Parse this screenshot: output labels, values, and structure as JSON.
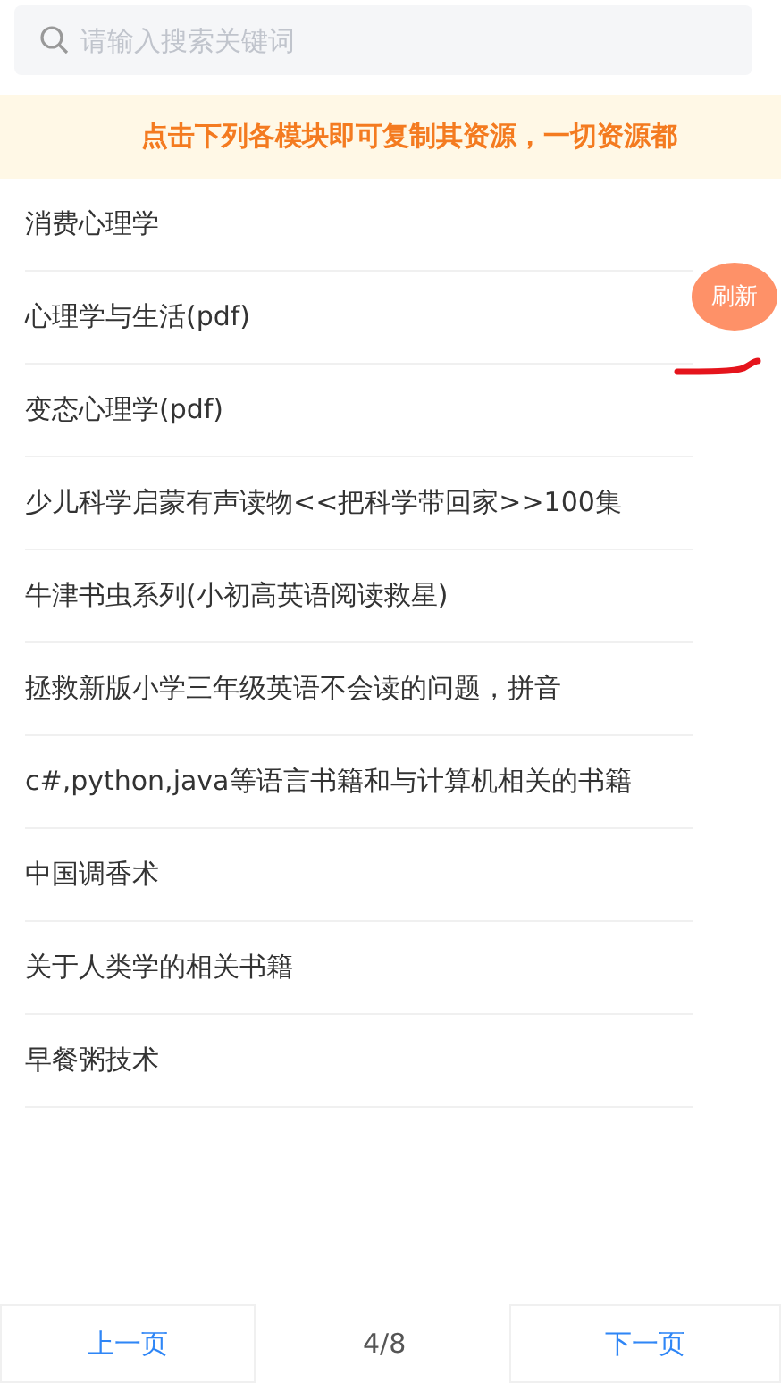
{
  "search": {
    "placeholder": "请输入搜索关键词"
  },
  "notice": "点击下列各模块即可复制其资源，一切资源都",
  "items": [
    "消费心理学",
    "心理学与生活(pdf)",
    "变态心理学(pdf)",
    "少儿科学启蒙有声读物<<把科学带回家>>100集",
    "牛津书虫系列(小初高英语阅读救星)",
    "拯救新版小学三年级英语不会读的问题，拼音",
    "c#,python,java等语言书籍和与计算机相关的书籍",
    "中国调香术",
    "关于人类学的相关书籍",
    "早餐粥技术"
  ],
  "refresh_button": "刷新",
  "pager": {
    "previous": "上一页",
    "page": "4/8",
    "next": "下一页"
  }
}
